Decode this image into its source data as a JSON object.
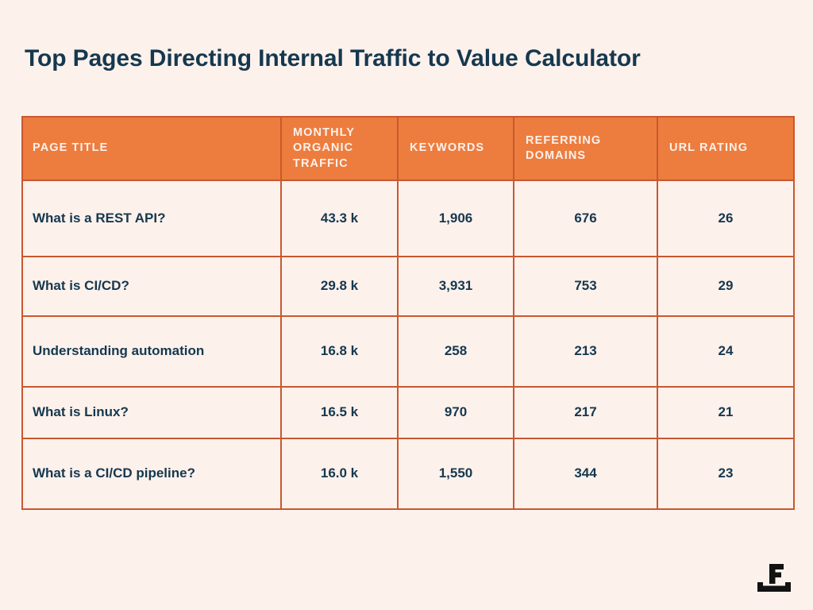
{
  "page": {
    "title": "Top Pages Directing Internal Traffic to Value Calculator",
    "background_color": "#fdf1ec",
    "title_color": "#15384f",
    "accent_color": "#ed7d3e",
    "border_color": "#c8582f"
  },
  "logo": {
    "name": "f-brand-logo",
    "letter": "F",
    "color": "#121212"
  },
  "table": {
    "columns": [
      {
        "key": "page_title",
        "label": "PAGE TITLE",
        "align": "left"
      },
      {
        "key": "monthly_organic_traffic",
        "label": "MONTHLY ORGANIC TRAFFIC",
        "align": "center"
      },
      {
        "key": "keywords",
        "label": "KEYWORDS",
        "align": "center"
      },
      {
        "key": "referring_domains",
        "label": "REFERRING DOMAINS",
        "align": "center"
      },
      {
        "key": "url_rating",
        "label": "URL RATING",
        "align": "center"
      }
    ],
    "rows": [
      {
        "page_title": "What is a REST API?",
        "monthly_organic_traffic": "43.3 k",
        "keywords": "1,906",
        "referring_domains": "676",
        "url_rating": "26"
      },
      {
        "page_title": "What is CI/CD?",
        "monthly_organic_traffic": "29.8 k",
        "keywords": "3,931",
        "referring_domains": "753",
        "url_rating": "29"
      },
      {
        "page_title": "Understanding automation",
        "monthly_organic_traffic": "16.8 k",
        "keywords": "258",
        "referring_domains": "213",
        "url_rating": "24"
      },
      {
        "page_title": "What is Linux?",
        "monthly_organic_traffic": "16.5 k",
        "keywords": "970",
        "referring_domains": "217",
        "url_rating": "21"
      },
      {
        "page_title": "What is a CI/CD pipeline?",
        "monthly_organic_traffic": "16.0 k",
        "keywords": "1,550",
        "referring_domains": "344",
        "url_rating": "23"
      }
    ]
  },
  "chart_data": {
    "type": "table",
    "title": "Top Pages Directing Internal Traffic to Value Calculator",
    "columns": [
      "PAGE TITLE",
      "MONTHLY ORGANIC TRAFFIC",
      "KEYWORDS",
      "REFERRING DOMAINS",
      "URL RATING"
    ],
    "rows": [
      [
        "What is a REST API?",
        "43.3 k",
        "1,906",
        "676",
        "26"
      ],
      [
        "What is CI/CD?",
        "29.8 k",
        "3,931",
        "753",
        "29"
      ],
      [
        "Understanding automation",
        "16.8 k",
        "258",
        "213",
        "24"
      ],
      [
        "What is Linux?",
        "16.5 k",
        "970",
        "217",
        "21"
      ],
      [
        "What is a CI/CD pipeline?",
        "16.0 k",
        "1,550",
        "344",
        "23"
      ]
    ],
    "numeric_values": {
      "monthly_organic_traffic": [
        43300,
        29800,
        16800,
        16500,
        16000
      ],
      "keywords": [
        1906,
        3931,
        258,
        970,
        1550
      ],
      "referring_domains": [
        676,
        753,
        213,
        217,
        344
      ],
      "url_rating": [
        26,
        29,
        24,
        21,
        23
      ]
    }
  }
}
